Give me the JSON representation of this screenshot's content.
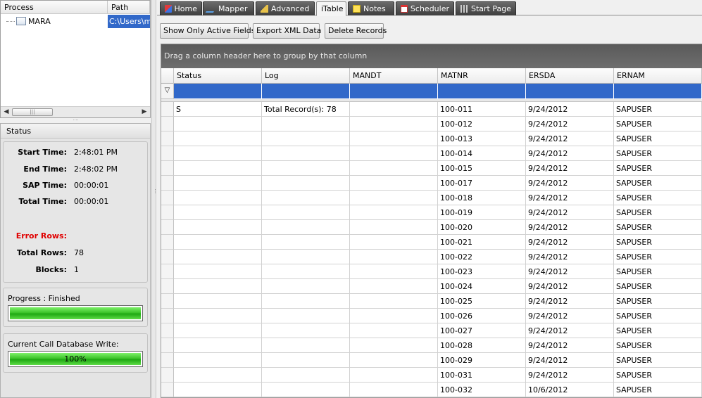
{
  "process_tree": {
    "columns": [
      "Process",
      "Path"
    ],
    "rows": [
      {
        "process": "MARA",
        "path": "C:\\Users\\ma"
      }
    ]
  },
  "status": {
    "title": "Status",
    "start_time_label": "Start Time:",
    "start_time": "2:48:01 PM",
    "end_time_label": "End Time:",
    "end_time": "2:48:02 PM",
    "sap_time_label": "SAP Time:",
    "sap_time": "00:00:01",
    "total_time_label": "Total Time:",
    "total_time": "00:00:01",
    "error_rows_label": "Error Rows:",
    "error_rows": "",
    "total_rows_label": "Total Rows:",
    "total_rows": "78",
    "blocks_label": "Blocks:",
    "blocks": "1",
    "progress_label": "Progress :  Finished",
    "progress_fraction": 1.0,
    "db_write_label": "Current Call Database Write:",
    "db_write_text": "100%",
    "db_write_fraction": 1.0
  },
  "tabs": [
    {
      "label": "Home",
      "icon": "home-icon"
    },
    {
      "label": "Mapper",
      "icon": "mapper-icon"
    },
    {
      "label": "Advanced",
      "icon": "advanced-icon"
    },
    {
      "label": "iTable",
      "icon": ""
    },
    {
      "label": "Notes",
      "icon": "notes-icon"
    },
    {
      "label": "Scheduler",
      "icon": "scheduler-icon"
    },
    {
      "label": "Start Page",
      "icon": "start-page-icon"
    }
  ],
  "active_tab": "iTable",
  "toolbar": {
    "show_active_label": "Show Only Active Fields",
    "export_xml_label": "Export XML Data",
    "delete_records_label": "Delete Records"
  },
  "grid": {
    "group_hint": "Drag a column header here to group by that column",
    "columns": [
      "Status",
      "Log",
      "MANDT",
      "MATNR",
      "ERSDA",
      "ERNAM"
    ],
    "rows": [
      [
        "S",
        "Total Record(s): 78",
        "",
        "100-011",
        "9/24/2012",
        "SAPUSER"
      ],
      [
        "",
        "",
        "",
        "100-012",
        "9/24/2012",
        "SAPUSER"
      ],
      [
        "",
        "",
        "",
        "100-013",
        "9/24/2012",
        "SAPUSER"
      ],
      [
        "",
        "",
        "",
        "100-014",
        "9/24/2012",
        "SAPUSER"
      ],
      [
        "",
        "",
        "",
        "100-015",
        "9/24/2012",
        "SAPUSER"
      ],
      [
        "",
        "",
        "",
        "100-017",
        "9/24/2012",
        "SAPUSER"
      ],
      [
        "",
        "",
        "",
        "100-018",
        "9/24/2012",
        "SAPUSER"
      ],
      [
        "",
        "",
        "",
        "100-019",
        "9/24/2012",
        "SAPUSER"
      ],
      [
        "",
        "",
        "",
        "100-020",
        "9/24/2012",
        "SAPUSER"
      ],
      [
        "",
        "",
        "",
        "100-021",
        "9/24/2012",
        "SAPUSER"
      ],
      [
        "",
        "",
        "",
        "100-022",
        "9/24/2012",
        "SAPUSER"
      ],
      [
        "",
        "",
        "",
        "100-023",
        "9/24/2012",
        "SAPUSER"
      ],
      [
        "",
        "",
        "",
        "100-024",
        "9/24/2012",
        "SAPUSER"
      ],
      [
        "",
        "",
        "",
        "100-025",
        "9/24/2012",
        "SAPUSER"
      ],
      [
        "",
        "",
        "",
        "100-026",
        "9/24/2012",
        "SAPUSER"
      ],
      [
        "",
        "",
        "",
        "100-027",
        "9/24/2012",
        "SAPUSER"
      ],
      [
        "",
        "",
        "",
        "100-028",
        "9/24/2012",
        "SAPUSER"
      ],
      [
        "",
        "",
        "",
        "100-029",
        "9/24/2012",
        "SAPUSER"
      ],
      [
        "",
        "",
        "",
        "100-031",
        "9/24/2012",
        "SAPUSER"
      ],
      [
        "",
        "",
        "",
        "100-032",
        "10/6/2012",
        "SAPUSER"
      ]
    ]
  }
}
